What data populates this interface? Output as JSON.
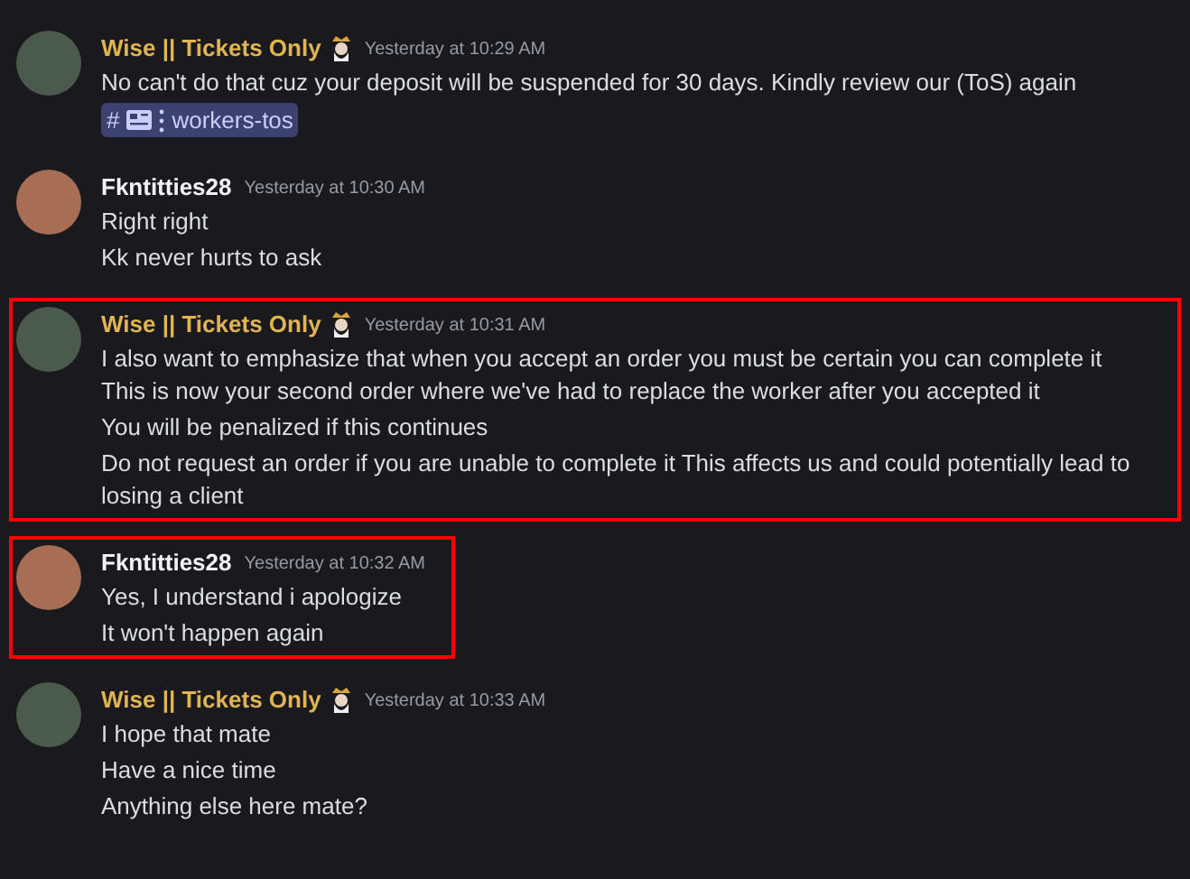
{
  "messages": [
    {
      "author": "Wise || Tickets Only",
      "color": "#e0b451",
      "badge": true,
      "time": "Yesterday at 10:29 AM",
      "highlighted": false,
      "lines": [
        "No can't do that cuz  your deposit will be suspended for 30 days. Kindly review our (ToS) again"
      ],
      "channel_mention": {
        "prefix": "#",
        "name": "workers-tos"
      }
    },
    {
      "author": "Fkntitties28",
      "color": "#f2f3f5",
      "badge": false,
      "time": "Yesterday at 10:30 AM",
      "highlighted": false,
      "lines": [
        "Right right",
        "Kk never hurts to ask"
      ]
    },
    {
      "author": "Wise || Tickets Only",
      "color": "#e0b451",
      "badge": true,
      "time": "Yesterday at 10:31 AM",
      "highlighted": true,
      "lines": [
        "I also want to emphasize that when you accept an order  you must be certain you can complete it This is now your second order where we've had to replace the worker after you accepted it",
        "You will be penalized if this continues",
        "Do not request an order if you are unable to complete it This  affects us and could potentially lead to losing a client"
      ]
    },
    {
      "author": "Fkntitties28",
      "color": "#f2f3f5",
      "badge": false,
      "time": "Yesterday at 10:32 AM",
      "highlighted": true,
      "lines": [
        "Yes, I understand i apologize",
        "It won't happen again"
      ]
    },
    {
      "author": "Wise || Tickets Only",
      "color": "#e0b451",
      "badge": true,
      "time": "Yesterday at 10:33 AM",
      "highlighted": false,
      "lines": [
        "I hope that  mate",
        "Have a nice time",
        "Anything else here mate?"
      ]
    }
  ]
}
